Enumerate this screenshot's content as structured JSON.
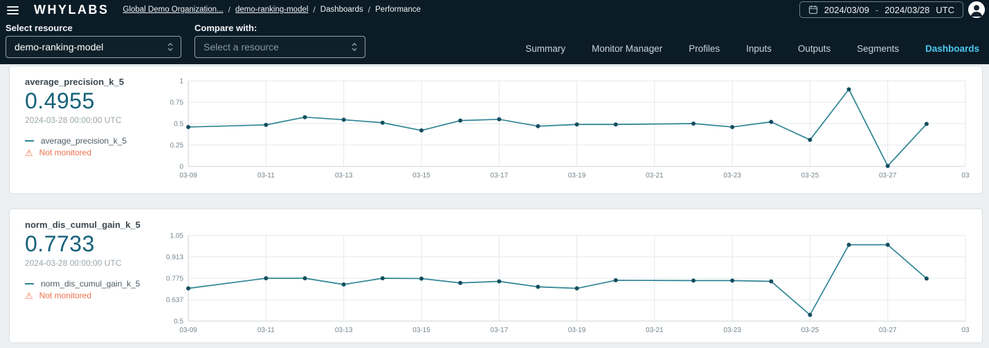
{
  "header": {
    "logo": "WHYLABS",
    "breadcrumb": [
      {
        "label": "Global Demo Organization...",
        "link": true
      },
      {
        "label": "demo-ranking-model",
        "link": true
      },
      {
        "label": "Dashboards",
        "link": false
      },
      {
        "label": "Performance",
        "link": false
      }
    ],
    "date_range": {
      "start": "2024/03/09",
      "separator": "-",
      "end": "2024/03/28",
      "timezone": "UTC"
    }
  },
  "toolbar": {
    "select_resource_label": "Select resource",
    "select_resource_value": "demo-ranking-model",
    "compare_label": "Compare with:",
    "compare_placeholder": "Select a resource",
    "tabs": [
      {
        "label": "Summary",
        "active": false
      },
      {
        "label": "Monitor Manager",
        "active": false
      },
      {
        "label": "Profiles",
        "active": false
      },
      {
        "label": "Inputs",
        "active": false
      },
      {
        "label": "Outputs",
        "active": false
      },
      {
        "label": "Segments",
        "active": false
      },
      {
        "label": "Dashboards",
        "active": true
      }
    ]
  },
  "icons": {
    "warning": "⚠"
  },
  "panels": [
    {
      "title": "average_precision_k_5",
      "value": "0.4955",
      "timestamp": "2024-03-28 00:00:00 UTC",
      "legend": "average_precision_k_5",
      "warning": "Not monitored"
    },
    {
      "title": "norm_dis_cumul_gain_k_5",
      "value": "0.7733",
      "timestamp": "2024-03-28 00:00:00 UTC",
      "legend": "norm_dis_cumul_gain_k_5",
      "warning": "Not monitored"
    }
  ],
  "chart_data": [
    {
      "type": "line",
      "title": "average_precision_k_5",
      "series": [
        {
          "name": "average_precision_k_5",
          "x": [
            "03-09",
            "03-11",
            "03-12",
            "03-13",
            "03-14",
            "03-15",
            "03-16",
            "03-17",
            "03-18",
            "03-19",
            "03-20",
            "03-22",
            "03-23",
            "03-24",
            "03-25",
            "03-26",
            "03-27",
            "03-28"
          ],
          "values": [
            0.46,
            0.485,
            0.575,
            0.545,
            0.51,
            0.42,
            0.535,
            0.55,
            0.47,
            0.49,
            0.49,
            0.5,
            0.46,
            0.52,
            0.31,
            0.9,
            0.005,
            0.4955
          ]
        }
      ],
      "x_tick_labels": [
        "03-09",
        "03-11",
        "03-13",
        "03-15",
        "03-17",
        "03-19",
        "03-21",
        "03-23",
        "03-25",
        "03-27",
        "03"
      ],
      "y_ticks": [
        "0",
        "0.25",
        "0.5",
        "0.75",
        "1"
      ],
      "ylim": [
        0,
        1
      ],
      "xlim_days": [
        0,
        20
      ],
      "grid": true,
      "line_color": "#2e8495",
      "dot_color": "#134e5f"
    },
    {
      "type": "line",
      "title": "norm_dis_cumul_gain_k_5",
      "series": [
        {
          "name": "norm_dis_cumul_gain_k_5",
          "x": [
            "03-09",
            "03-11",
            "03-12",
            "03-13",
            "03-14",
            "03-15",
            "03-16",
            "03-17",
            "03-18",
            "03-19",
            "03-20",
            "03-22",
            "03-23",
            "03-24",
            "03-25",
            "03-26",
            "03-27",
            "03-28"
          ],
          "values": [
            0.71,
            0.775,
            0.775,
            0.735,
            0.775,
            0.773,
            0.745,
            0.755,
            0.72,
            0.71,
            0.762,
            0.76,
            0.76,
            0.755,
            0.54,
            0.99,
            0.99,
            0.7733
          ]
        }
      ],
      "x_tick_labels": [
        "03-09",
        "03-11",
        "03-13",
        "03-15",
        "03-17",
        "03-19",
        "03-21",
        "03-23",
        "03-25",
        "03-27",
        "03"
      ],
      "y_ticks": [
        "0.5",
        "0.637",
        "0.775",
        "0.913",
        "1.05"
      ],
      "ylim": [
        0.5,
        1.05
      ],
      "xlim_days": [
        0,
        20
      ],
      "grid": true,
      "line_color": "#2e8495",
      "dot_color": "#134e5f"
    }
  ],
  "colors": {
    "header_bg": "#0b1c27",
    "page_bg": "#edf0f2",
    "accent_teal": "#14607a",
    "line_teal": "#2e8495",
    "warning_orange": "#ed714b",
    "active_tab": "#4ec9ee",
    "grid_line": "#e3e8eb"
  }
}
